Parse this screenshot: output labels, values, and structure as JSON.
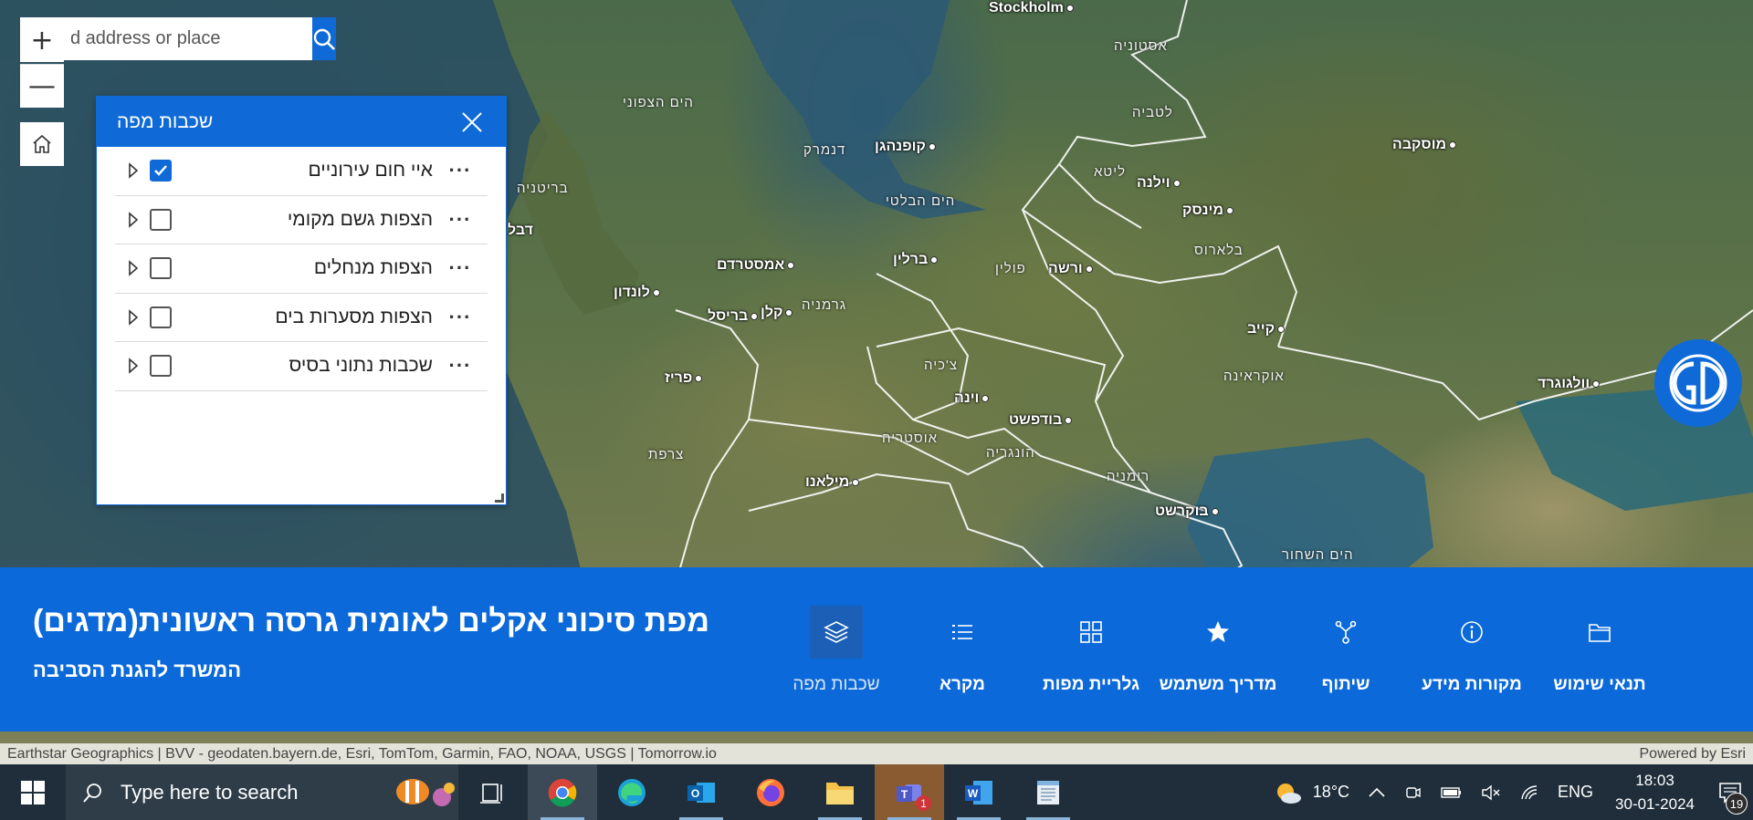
{
  "search": {
    "placeholder": "Find address or place",
    "value": "d address or place"
  },
  "zoom": {
    "in_label": "+",
    "out_label": "—"
  },
  "layers_panel": {
    "title": "שכבות מפה",
    "items": [
      {
        "label": "איי חום עירוניים",
        "checked": true
      },
      {
        "label": "הצפות גשם מקומי",
        "checked": false
      },
      {
        "label": "הצפות מנחלים",
        "checked": false
      },
      {
        "label": "הצפות מסערות בים",
        "checked": false
      },
      {
        "label": "שכבות נתוני בסיס",
        "checked": false
      }
    ],
    "more_label": "···"
  },
  "map": {
    "cities": {
      "stockholm": "Stockholm",
      "moscow": "מוסקבה",
      "copenhagen": "קופנהגן",
      "vilnius": "וילנה",
      "minsk": "מינסק",
      "berlin": "ברלין",
      "warsaw": "ורשה",
      "amsterdam": "אמסטרדם",
      "london": "לונדון",
      "brussels": "בריסל",
      "cologne": "קלן",
      "kyiv": "קייב",
      "paris": "פריז",
      "vienna": "וינה",
      "budapest": "בודפשט",
      "volgograd": "וולגוגרד",
      "milan": "מילאנו",
      "bucharest": "בוקרשט",
      "dublin": "דבל"
    },
    "regions": {
      "estonia": "אסטוניה",
      "latvia": "לטביה",
      "lithuania": "ליטא",
      "north_sea": "הים הצפוני",
      "denmark": "דנמרק",
      "baltic_sea": "הים הבלטי",
      "belarus": "בלארוס",
      "britain": "בריטניה",
      "poland": "פולין",
      "germany": "גרמניה",
      "czechia": "צ'כיה",
      "ukraine": "אוקראינה",
      "austria": "אוסטריה",
      "hungary": "הונגריה",
      "france": "צרפת",
      "romania": "רומניה",
      "black_sea": "הים השחור"
    }
  },
  "app_bar": {
    "title": "מפת סיכוני אקלים לאומית גרסה ראשונית(מדגים)",
    "subtitle": "המשרד להגנת הסביבה",
    "tools": [
      {
        "id": "layers",
        "label": "שכבות מפה",
        "icon": "layers-icon",
        "active": true
      },
      {
        "id": "legend",
        "label": "מקרא",
        "icon": "legend-icon",
        "active": false
      },
      {
        "id": "gallery",
        "label": "גלריית מפות",
        "icon": "gallery-icon",
        "active": false
      },
      {
        "id": "guide",
        "label": "מדריך משתמש",
        "icon": "star-icon",
        "active": false
      },
      {
        "id": "share",
        "label": "שיתוף",
        "icon": "share-icon",
        "active": false
      },
      {
        "id": "sources",
        "label": "מקורות מידע",
        "icon": "info-icon",
        "active": false
      },
      {
        "id": "terms",
        "label": "תנאי שימוש",
        "icon": "folder-icon",
        "active": false
      }
    ]
  },
  "attribution": {
    "text": "Earthstar Geographics | BVV - geodaten.bayern.de, Esri, TomTom, Garmin, FAO, NOAA, USGS | Tomorrow.io",
    "powered": "Powered by Esri"
  },
  "taskbar": {
    "search_placeholder": "Type here to search",
    "apps": [
      "task-view",
      "chrome",
      "edge",
      "outlook",
      "firefox",
      "file-explorer",
      "teams",
      "word",
      "notepad"
    ],
    "teams_badge": "1",
    "weather": "18°C",
    "language": "ENG",
    "time": "18:03",
    "date": "30-01-2024",
    "notifications": "19"
  },
  "colors": {
    "accent": "#0c69d9",
    "panel_header": "#0f6ad8",
    "taskbar": "#1f2e3a"
  }
}
